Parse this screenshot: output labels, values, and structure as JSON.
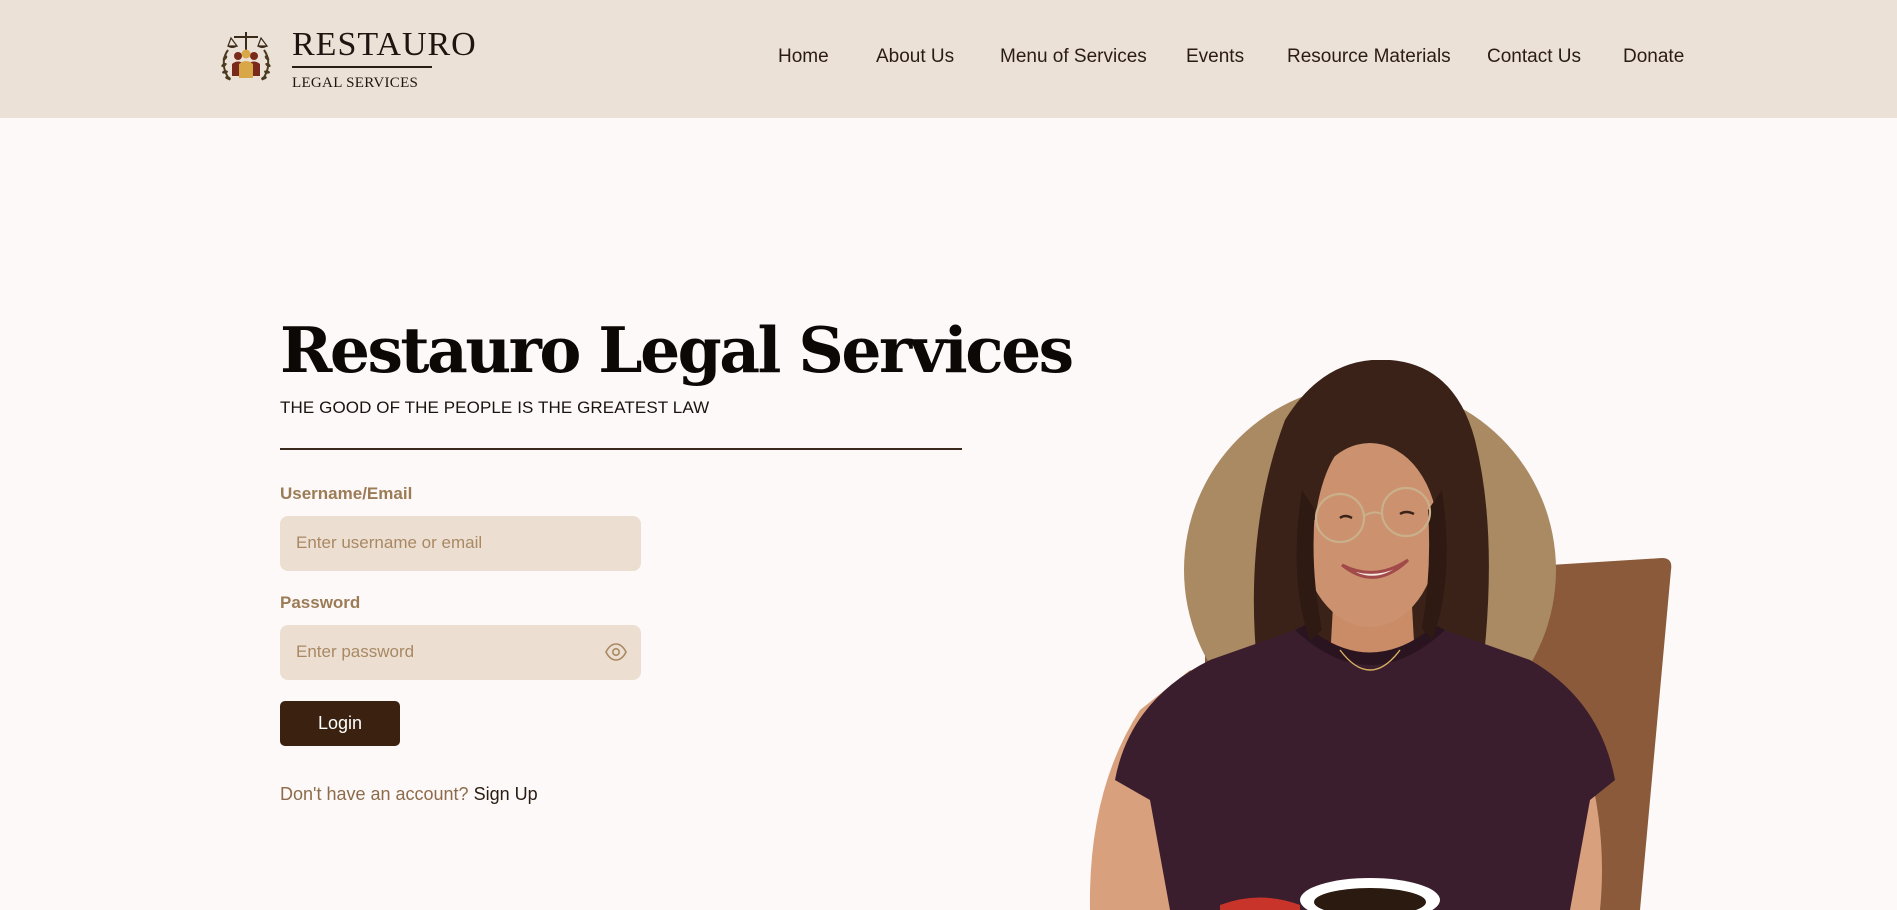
{
  "brand": {
    "title": "RESTAURO",
    "subtitle": "LEGAL SERVICES"
  },
  "nav": {
    "items": [
      "Home",
      "About Us",
      "Menu of Services",
      "Events",
      "Resource Materials",
      "Contact Us",
      "Donate"
    ]
  },
  "hero": {
    "title": "Restauro Legal Services",
    "tagline": "THE GOOD OF THE PEOPLE IS THE GREATEST LAW"
  },
  "form": {
    "username_label": "Username/Email",
    "username_placeholder": "Enter username or email",
    "password_label": "Password",
    "password_placeholder": "Enter password",
    "login_label": "Login",
    "signup_prompt": "Don't have an account?",
    "signup_link": "Sign Up"
  },
  "colors": {
    "header_bg": "#ece1d6",
    "page_bg": "#fcf9f8",
    "accent_dark": "#3b210f",
    "label_tan": "#9c7c56",
    "input_bg": "#ecdfd2",
    "circle_tan": "#a98a62",
    "shape_brown": "#8a5a3a"
  },
  "icons": {
    "logo": "scales-of-justice-emblem",
    "password_toggle": "eye-icon"
  }
}
